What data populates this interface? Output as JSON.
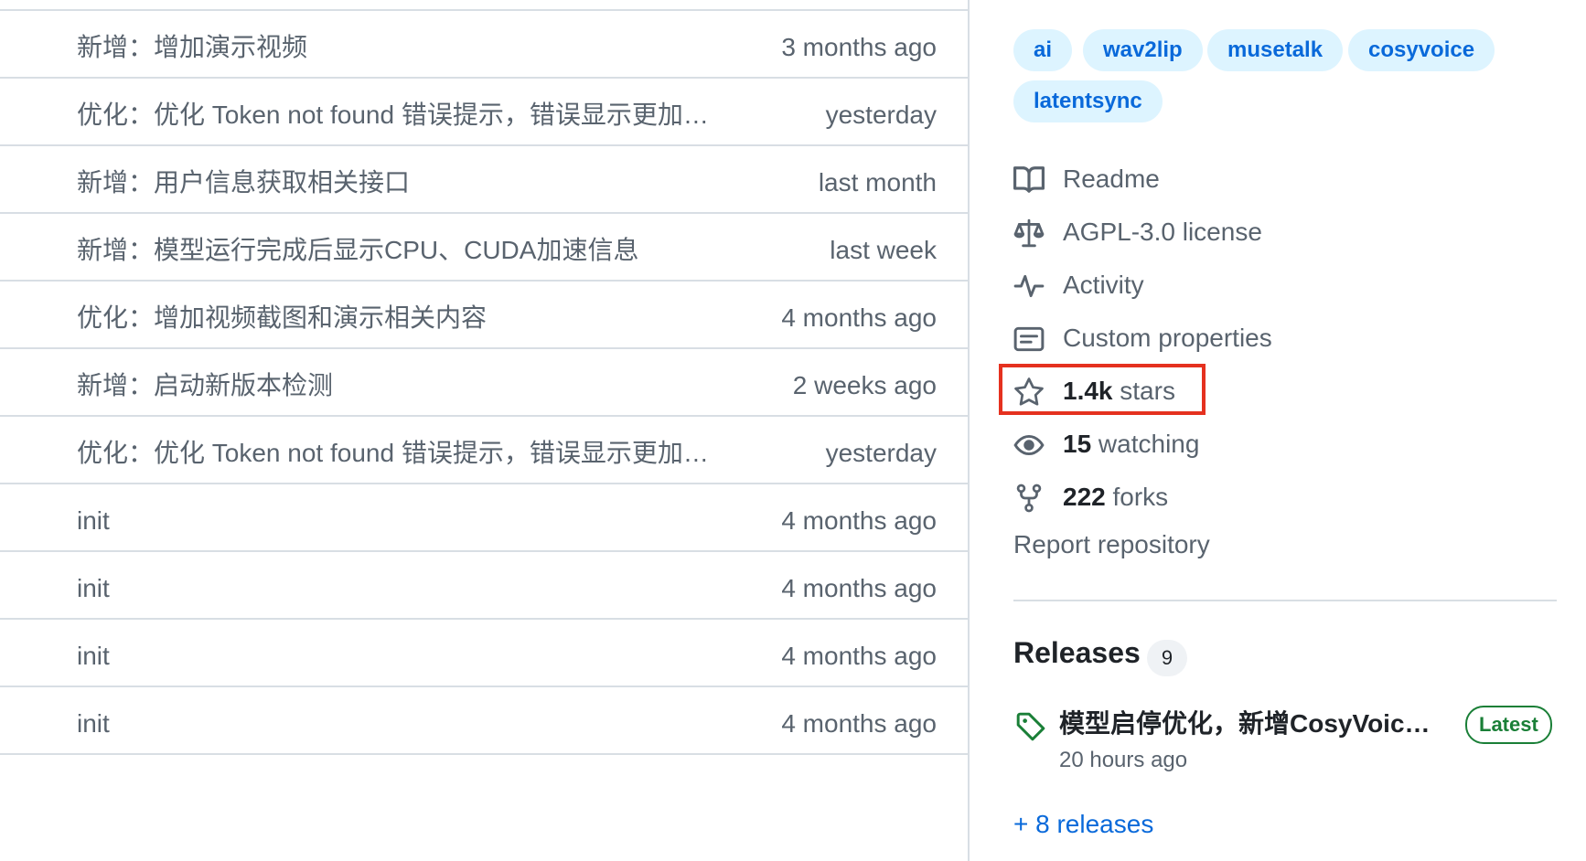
{
  "commits": [
    {
      "message": "新增：增加演示视频",
      "time": "3 months ago"
    },
    {
      "message": "优化：优化 Token not found 错误提示，错误显示更加…",
      "time": "yesterday"
    },
    {
      "message": "新增：用户信息获取相关接口",
      "time": "last month"
    },
    {
      "message": "新增：模型运行完成后显示CPU、CUDA加速信息",
      "time": "last week"
    },
    {
      "message": "优化：增加视频截图和演示相关内容",
      "time": "4 months ago"
    },
    {
      "message": "新增：启动新版本检测",
      "time": "2 weeks ago"
    },
    {
      "message": "优化：优化 Token not found 错误提示，错误显示更加…",
      "time": "yesterday"
    },
    {
      "message": "init",
      "time": "4 months ago"
    },
    {
      "message": "init",
      "time": "4 months ago"
    },
    {
      "message": "init",
      "time": "4 months ago"
    },
    {
      "message": "init",
      "time": "4 months ago"
    }
  ],
  "topics": [
    "ai",
    "wav2lip",
    "musetalk",
    "cosyvoice",
    "latentsync"
  ],
  "meta": {
    "readme": "Readme",
    "license": "AGPL-3.0 license",
    "activity": "Activity",
    "custom_properties": "Custom properties",
    "stars_count": "1.4k",
    "stars_label": " stars",
    "watching_count": "15",
    "watching_label": " watching",
    "forks_count": "222",
    "forks_label": " forks",
    "report": "Report repository"
  },
  "releases": {
    "title": "Releases",
    "count": "9",
    "latest_name": "模型启停优化，新增CosyVoice…",
    "latest_badge": "Latest",
    "latest_time": "20 hours ago",
    "more": "+ 8 releases"
  },
  "icons": {
    "readme": "book-icon",
    "license": "law-scale-icon",
    "activity": "pulse-icon",
    "custom_properties": "note-icon",
    "stars": "star-icon",
    "watching": "eye-icon",
    "forks": "repo-forked-icon",
    "release": "tag-icon"
  },
  "colors": {
    "link": "#0969da",
    "muted": "#59636e",
    "topic_bg": "#ddf4ff",
    "latest_green": "#1a7f37",
    "highlight_red": "#e5311f"
  }
}
